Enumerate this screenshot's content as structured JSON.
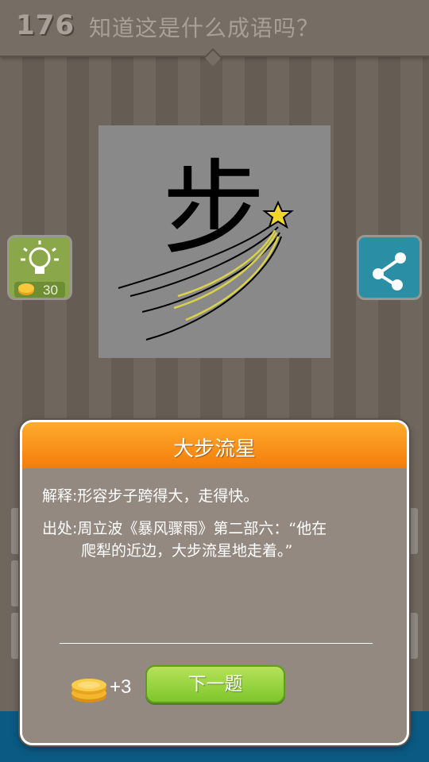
{
  "header": {
    "level": "176",
    "question": "知道这是什么成语吗？"
  },
  "puzzle": {
    "character": "步",
    "decoration": "shooting-star"
  },
  "hint_button": {
    "icon": "lightbulb-icon",
    "coin_icon": "coin-icon",
    "cost": "30",
    "color": "#8aa84a"
  },
  "share_button": {
    "icon": "share-icon",
    "color": "#2a8fa5"
  },
  "result_dialog": {
    "title": "大步流星",
    "explanation": "解释:形容步子跨得大，走得快。",
    "source_line1": "出处:周立波《暴风骤雨》第二部六：“他在",
    "source_line2": "爬犁的近边，大步流星地走着。”",
    "reward": "+3",
    "next_label": "下一题",
    "header_color": "#f78a14",
    "button_color": "#8fd13a"
  }
}
